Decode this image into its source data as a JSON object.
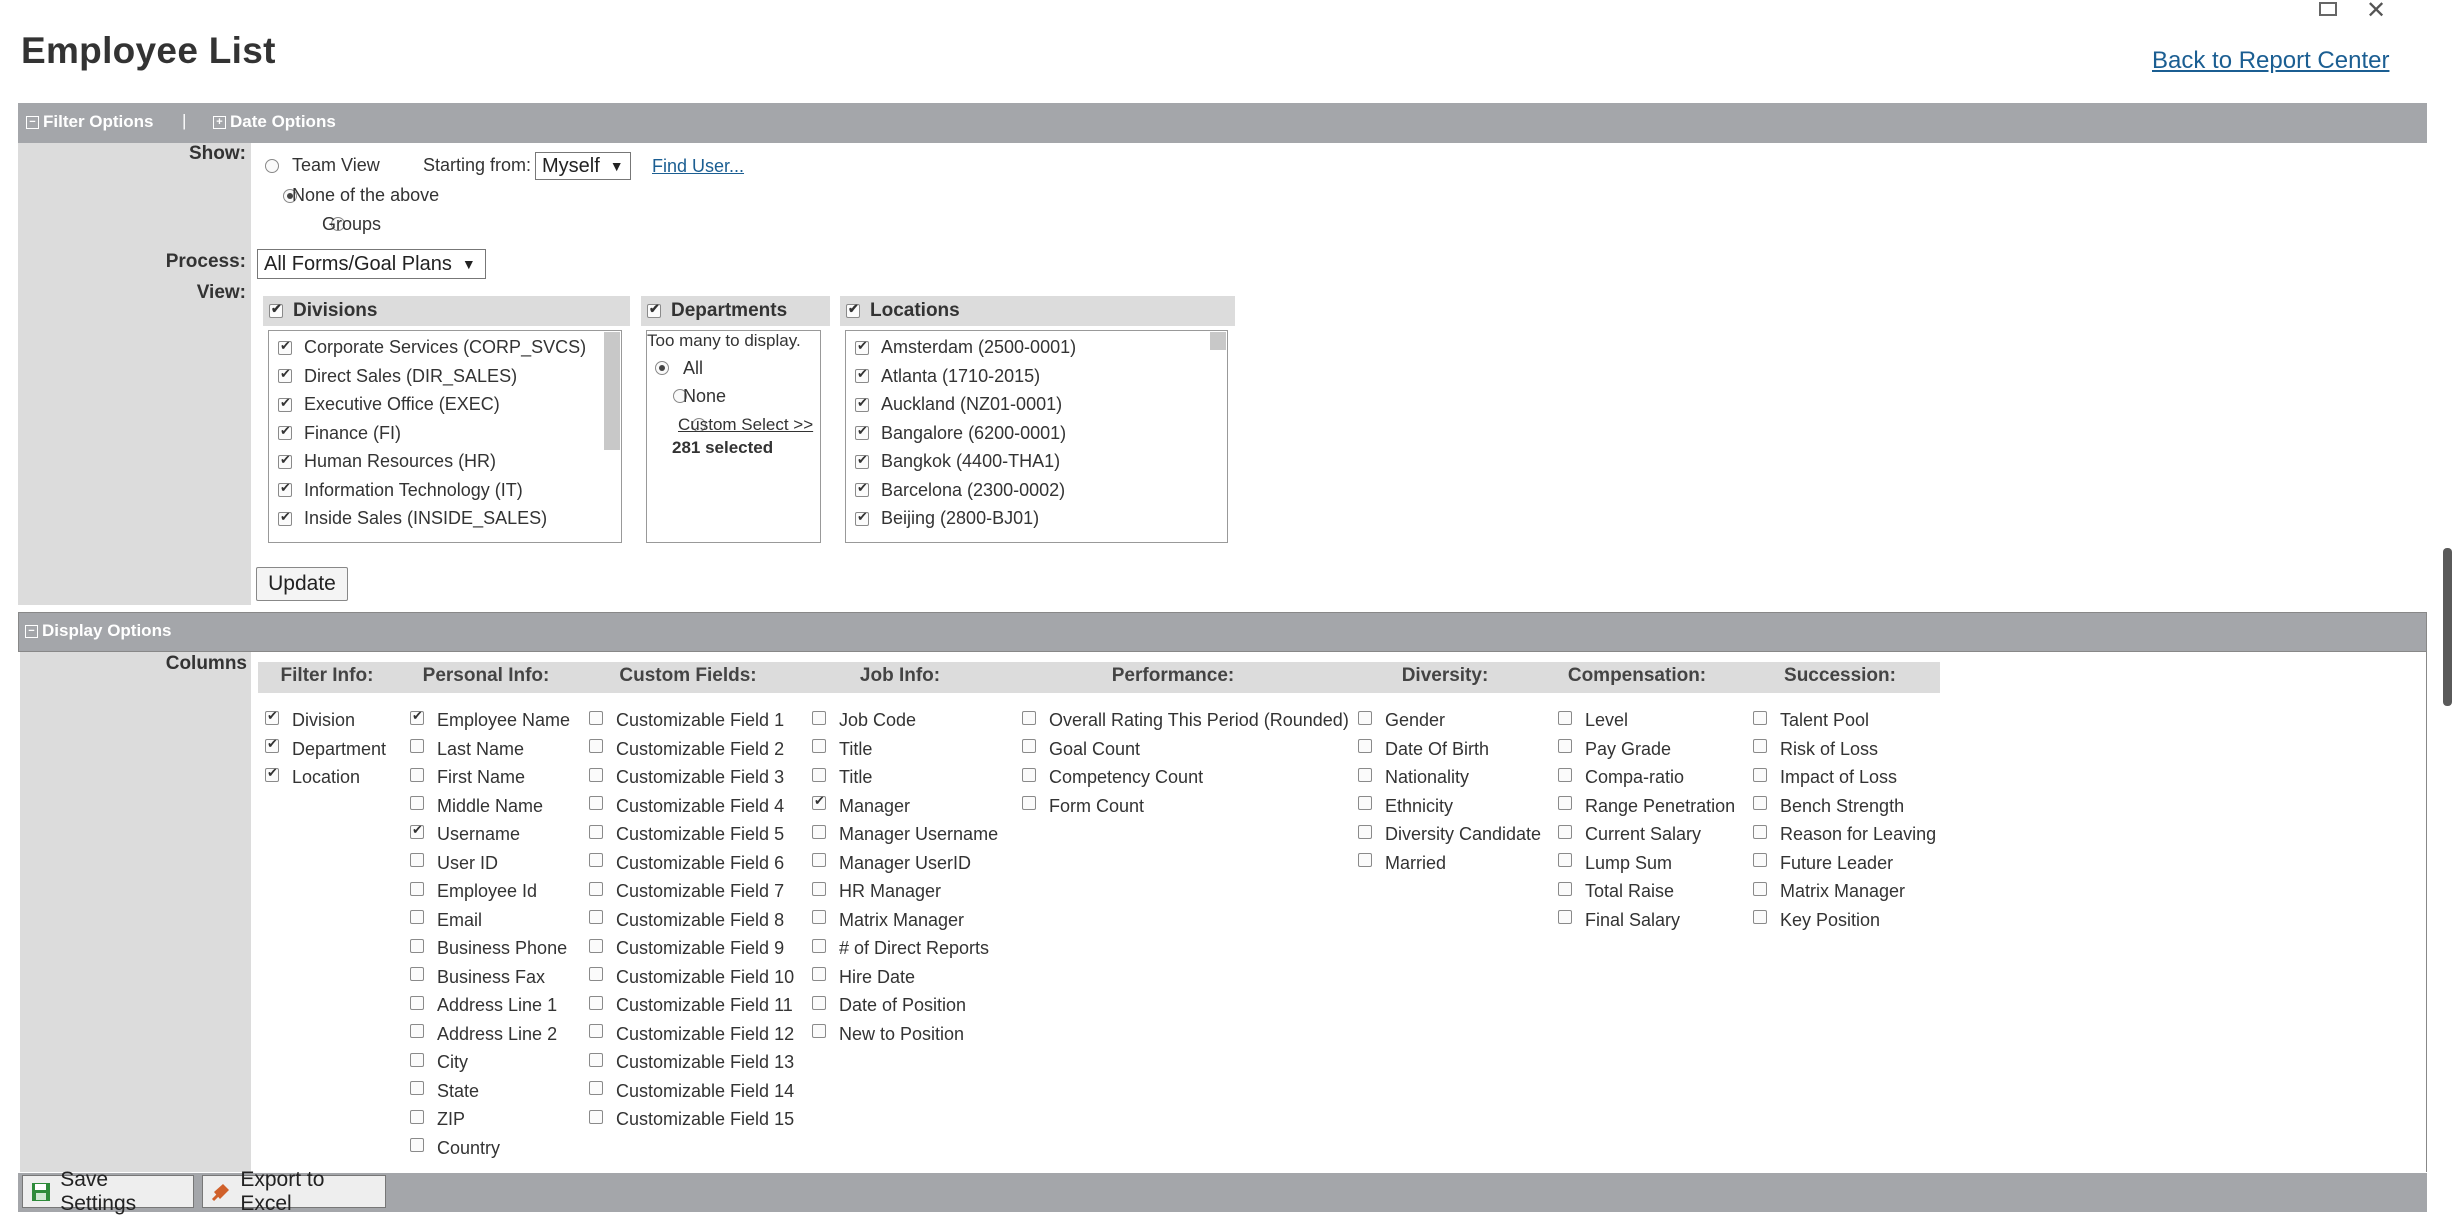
{
  "page": {
    "title": "Employee List",
    "back_link": "Back to Report Center"
  },
  "window": {
    "restore_icon": "restore-icon",
    "close_icon": "✕"
  },
  "filter_bar": {
    "filter_options": "Filter Options",
    "separator": "|",
    "date_options": "Date Options"
  },
  "show": {
    "label": "Show:",
    "team_view": "Team View",
    "starting_from_label": "Starting from:",
    "starting_from_value": "Myself",
    "find_user": "Find User...",
    "none_of_above": "None of the above",
    "groups": "Groups"
  },
  "process": {
    "label": "Process:",
    "value": "All Forms/Goal Plans"
  },
  "view": {
    "label": "View:",
    "divisions": {
      "title": "Divisions",
      "items": [
        "Corporate Services (CORP_SVCS)",
        "Direct Sales (DIR_SALES)",
        "Executive Office (EXEC)",
        "Finance (FI)",
        "Human Resources (HR)",
        "Information Technology (IT)",
        "Inside Sales (INSIDE_SALES)"
      ]
    },
    "departments": {
      "title": "Departments",
      "message": "Too many to display.",
      "all": "All",
      "none": "None",
      "custom": "Custom Select >>",
      "selected_count": "281 selected"
    },
    "locations": {
      "title": "Locations",
      "items": [
        "Amsterdam (2500-0001)",
        "Atlanta (1710-2015)",
        "Auckland (NZ01-0001)",
        "Bangalore (6200-0001)",
        "Bangkok (4400-THA1)",
        "Barcelona (2300-0002)",
        "Beijing (2800-BJ01)"
      ]
    },
    "update_button": "Update"
  },
  "display_options": {
    "title": "Display Options",
    "columns_label": "Columns",
    "groups": [
      {
        "heading": "Filter Info:",
        "items": [
          {
            "label": "Division",
            "checked": true
          },
          {
            "label": "Department",
            "checked": true
          },
          {
            "label": "Location",
            "checked": true
          }
        ]
      },
      {
        "heading": "Personal Info:",
        "items": [
          {
            "label": "Employee Name",
            "checked": true
          },
          {
            "label": "Last Name",
            "checked": false
          },
          {
            "label": "First Name",
            "checked": false
          },
          {
            "label": "Middle Name",
            "checked": false
          },
          {
            "label": "Username",
            "checked": true
          },
          {
            "label": "User ID",
            "checked": false
          },
          {
            "label": "Employee Id",
            "checked": false
          },
          {
            "label": "Email",
            "checked": false
          },
          {
            "label": "Business Phone",
            "checked": false
          },
          {
            "label": "Business Fax",
            "checked": false
          },
          {
            "label": "Address Line 1",
            "checked": false
          },
          {
            "label": "Address Line 2",
            "checked": false
          },
          {
            "label": "City",
            "checked": false
          },
          {
            "label": "State",
            "checked": false
          },
          {
            "label": "ZIP",
            "checked": false
          },
          {
            "label": "Country",
            "checked": false
          }
        ]
      },
      {
        "heading": "Custom Fields:",
        "items": [
          {
            "label": "Customizable Field 1",
            "checked": false
          },
          {
            "label": "Customizable Field 2",
            "checked": false
          },
          {
            "label": "Customizable Field 3",
            "checked": false
          },
          {
            "label": "Customizable Field 4",
            "checked": false
          },
          {
            "label": "Customizable Field 5",
            "checked": false
          },
          {
            "label": "Customizable Field 6",
            "checked": false
          },
          {
            "label": "Customizable Field 7",
            "checked": false
          },
          {
            "label": "Customizable Field 8",
            "checked": false
          },
          {
            "label": "Customizable Field 9",
            "checked": false
          },
          {
            "label": "Customizable Field 10",
            "checked": false
          },
          {
            "label": "Customizable Field 11",
            "checked": false
          },
          {
            "label": "Customizable Field 12",
            "checked": false
          },
          {
            "label": "Customizable Field 13",
            "checked": false
          },
          {
            "label": "Customizable Field 14",
            "checked": false
          },
          {
            "label": "Customizable Field 15",
            "checked": false
          }
        ]
      },
      {
        "heading": "Job Info:",
        "items": [
          {
            "label": "Job Code",
            "checked": false
          },
          {
            "label": "Title",
            "checked": false
          },
          {
            "label": "Title",
            "checked": false
          },
          {
            "label": "Manager",
            "checked": true
          },
          {
            "label": "Manager Username",
            "checked": false
          },
          {
            "label": "Manager UserID",
            "checked": false
          },
          {
            "label": "HR Manager",
            "checked": false
          },
          {
            "label": "Matrix Manager",
            "checked": false
          },
          {
            "label": "# of Direct Reports",
            "checked": false
          },
          {
            "label": "Hire Date",
            "checked": false
          },
          {
            "label": "Date of Position",
            "checked": false
          },
          {
            "label": "New to Position",
            "checked": false
          }
        ]
      },
      {
        "heading": "Performance:",
        "items": [
          {
            "label": "Overall Rating This Period (Rounded)",
            "checked": false
          },
          {
            "label": "Goal Count",
            "checked": false
          },
          {
            "label": "Competency Count",
            "checked": false
          },
          {
            "label": "Form Count",
            "checked": false
          }
        ]
      },
      {
        "heading": "Diversity:",
        "items": [
          {
            "label": "Gender",
            "checked": false
          },
          {
            "label": "Date Of Birth",
            "checked": false
          },
          {
            "label": "Nationality",
            "checked": false
          },
          {
            "label": "Ethnicity",
            "checked": false
          },
          {
            "label": "Diversity Candidate",
            "checked": false
          },
          {
            "label": "Married",
            "checked": false
          }
        ]
      },
      {
        "heading": "Compensation:",
        "items": [
          {
            "label": "Level",
            "checked": false
          },
          {
            "label": "Pay Grade",
            "checked": false
          },
          {
            "label": "Compa-ratio",
            "checked": false
          },
          {
            "label": "Range Penetration",
            "checked": false
          },
          {
            "label": "Current Salary",
            "checked": false
          },
          {
            "label": "Lump Sum",
            "checked": false
          },
          {
            "label": "Total Raise",
            "checked": false
          },
          {
            "label": "Final Salary",
            "checked": false
          }
        ]
      },
      {
        "heading": "Succession:",
        "items": [
          {
            "label": "Talent Pool",
            "checked": false
          },
          {
            "label": "Risk of Loss",
            "checked": false
          },
          {
            "label": "Impact of Loss",
            "checked": false
          },
          {
            "label": "Bench Strength",
            "checked": false
          },
          {
            "label": "Reason for Leaving",
            "checked": false
          },
          {
            "label": "Future Leader",
            "checked": false
          },
          {
            "label": "Matrix Manager",
            "checked": false
          },
          {
            "label": "Key Position",
            "checked": false
          }
        ]
      }
    ]
  },
  "footer": {
    "save_settings": "Save Settings",
    "export_excel": "Export to Excel"
  },
  "colors": {
    "bar": "#a4a6aa",
    "label_column": "#dcdcdc",
    "link": "#1b5e92",
    "save_icon": "#2e8b3a",
    "excel_icon": "#d0602a"
  }
}
